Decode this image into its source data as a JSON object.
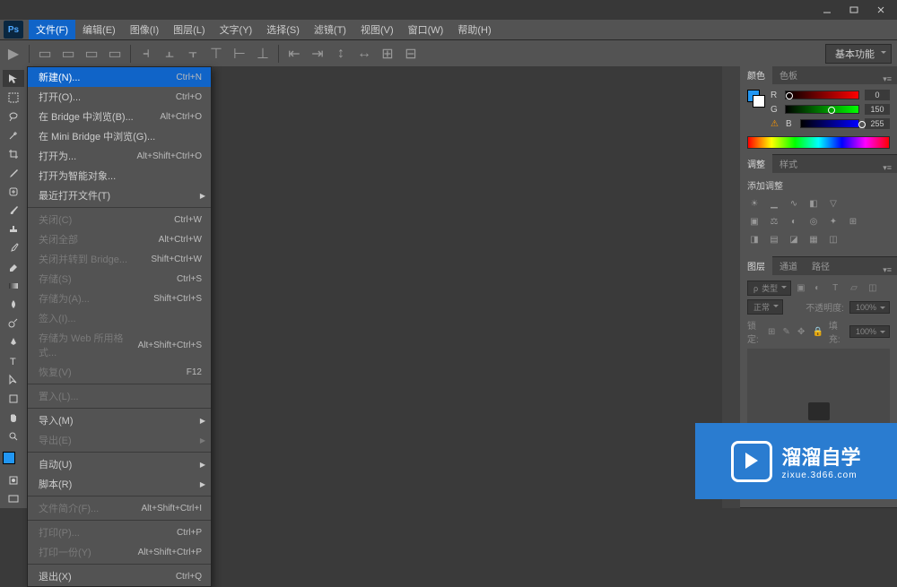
{
  "menubar": [
    "文件(F)",
    "编辑(E)",
    "图像(I)",
    "图层(L)",
    "文字(Y)",
    "选择(S)",
    "滤镜(T)",
    "视图(V)",
    "窗口(W)",
    "帮助(H)"
  ],
  "app_logo": "Ps",
  "workspace_label": "基本功能",
  "file_menu": [
    {
      "label": "新建(N)...",
      "shortcut": "Ctrl+N",
      "sel": true
    },
    {
      "label": "打开(O)...",
      "shortcut": "Ctrl+O"
    },
    {
      "label": "在 Bridge 中浏览(B)...",
      "shortcut": "Alt+Ctrl+O"
    },
    {
      "label": "在 Mini Bridge 中浏览(G)..."
    },
    {
      "label": "打开为...",
      "shortcut": "Alt+Shift+Ctrl+O"
    },
    {
      "label": "打开为智能对象..."
    },
    {
      "label": "最近打开文件(T)",
      "sub": true
    },
    {
      "sep": true
    },
    {
      "label": "关闭(C)",
      "shortcut": "Ctrl+W",
      "disabled": true
    },
    {
      "label": "关闭全部",
      "shortcut": "Alt+Ctrl+W",
      "disabled": true
    },
    {
      "label": "关闭并转到 Bridge...",
      "shortcut": "Shift+Ctrl+W",
      "disabled": true
    },
    {
      "label": "存储(S)",
      "shortcut": "Ctrl+S",
      "disabled": true
    },
    {
      "label": "存储为(A)...",
      "shortcut": "Shift+Ctrl+S",
      "disabled": true
    },
    {
      "label": "签入(I)...",
      "disabled": true
    },
    {
      "label": "存储为 Web 所用格式...",
      "shortcut": "Alt+Shift+Ctrl+S",
      "disabled": true
    },
    {
      "label": "恢复(V)",
      "shortcut": "F12",
      "disabled": true
    },
    {
      "sep": true
    },
    {
      "label": "置入(L)...",
      "disabled": true
    },
    {
      "sep": true
    },
    {
      "label": "导入(M)",
      "sub": true
    },
    {
      "label": "导出(E)",
      "sub": true,
      "disabled": true
    },
    {
      "sep": true
    },
    {
      "label": "自动(U)",
      "sub": true
    },
    {
      "label": "脚本(R)",
      "sub": true
    },
    {
      "sep": true
    },
    {
      "label": "文件简介(F)...",
      "shortcut": "Alt+Shift+Ctrl+I",
      "disabled": true
    },
    {
      "sep": true
    },
    {
      "label": "打印(P)...",
      "shortcut": "Ctrl+P",
      "disabled": true
    },
    {
      "label": "打印一份(Y)",
      "shortcut": "Alt+Shift+Ctrl+P",
      "disabled": true
    },
    {
      "sep": true
    },
    {
      "label": "退出(X)",
      "shortcut": "Ctrl+Q"
    }
  ],
  "panels": {
    "color": {
      "tabs": [
        "颜色",
        "色板"
      ],
      "r_label": "R",
      "g_label": "G",
      "b_label": "B",
      "r": "0",
      "g": "150",
      "b": "255"
    },
    "adjust": {
      "tabs": [
        "调整",
        "样式"
      ],
      "title": "添加调整"
    },
    "layers": {
      "tabs": [
        "图层",
        "通道",
        "路径"
      ],
      "type_label": "类型",
      "blend": "正常",
      "opacity_label": "不透明度:",
      "opacity": "100%",
      "lock_label": "锁定:",
      "fill_label": "填充:",
      "fill": "100%"
    }
  },
  "watermark": {
    "cn": "溜溜自学",
    "en": "zixue.3d66.com"
  }
}
